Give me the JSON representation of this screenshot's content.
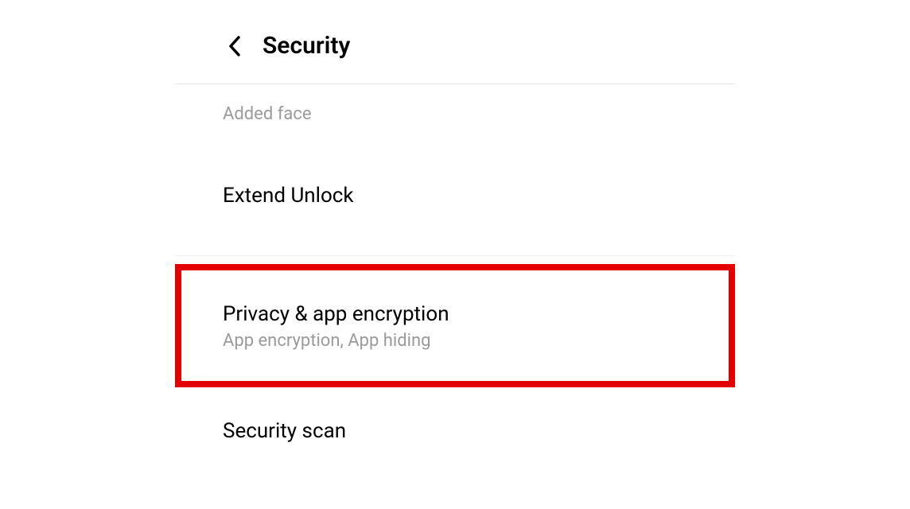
{
  "header": {
    "title": "Security"
  },
  "sections": {
    "added_face_label": "Added face"
  },
  "items": {
    "extend_unlock": {
      "title": "Extend Unlock"
    },
    "privacy_encryption": {
      "title": "Privacy & app encryption",
      "subtitle": "App encryption, App hiding"
    },
    "security_scan": {
      "title": "Security scan"
    }
  }
}
